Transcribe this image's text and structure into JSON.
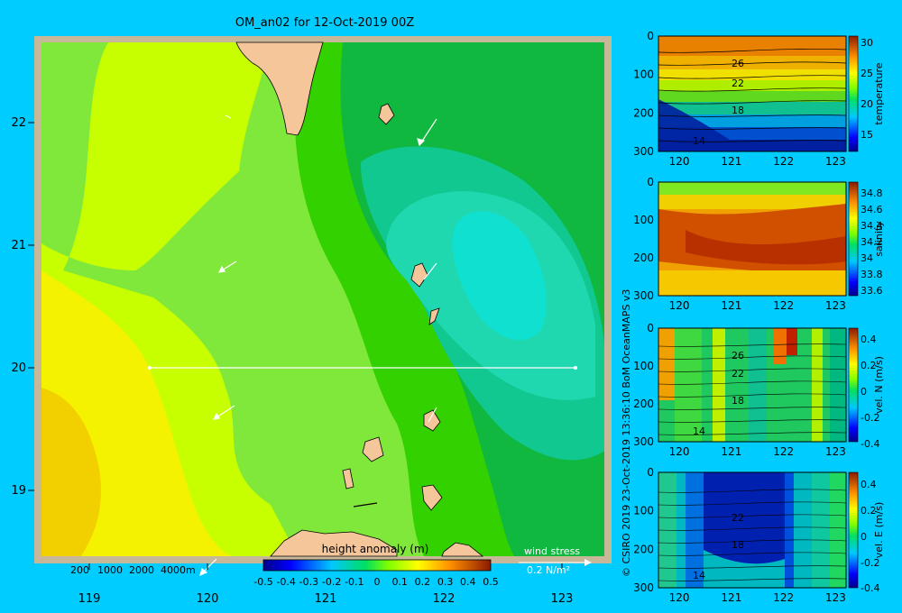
{
  "title": "OM_an02 for 12-Oct-2019 00Z",
  "credit": "© CSIRO 2019   23-Oct-2019 13:36:10 BoM OceanMAPS v3",
  "colors": {
    "background": "#00ccff",
    "land": "#f5c69a",
    "frame": "#c8b89a",
    "transect": "#ffffff",
    "wind_vector": "#ffffff"
  },
  "map": {
    "x_ticks": [
      "119",
      "120",
      "121",
      "122",
      "123"
    ],
    "y_ticks": [
      "22",
      "21",
      "20",
      "19"
    ],
    "depth_labels": [
      "200",
      "1000",
      "2000",
      "4000m"
    ],
    "colorbar_title": "height anomaly (m)",
    "colorbar_ticks": [
      "-0.5",
      "-0.4",
      "-0.3",
      "-0.2",
      "-0.1",
      "0",
      "0.1",
      "0.2",
      "0.3",
      "0.4",
      "0.5"
    ],
    "wind_stress_label": "wind stress",
    "wind_stress_value": "0.2 N/m²"
  },
  "panels": [
    {
      "id": "temperature",
      "ylabel": "temperature",
      "cbar_ticks": [
        "30",
        "25",
        "20",
        "15"
      ],
      "contour_labels": [
        "26",
        "22",
        "18",
        "14"
      ]
    },
    {
      "id": "salinity",
      "ylabel": "salinity",
      "cbar_ticks": [
        "34.8",
        "34.6",
        "34.4",
        "34.2",
        "34",
        "33.8",
        "33.6"
      ],
      "contour_labels": []
    },
    {
      "id": "vel-n",
      "ylabel": "vel. N (m/s)",
      "cbar_ticks": [
        "0.4",
        "0.2",
        "0",
        "-0.2",
        "-0.4"
      ],
      "contour_labels": [
        "26",
        "22",
        "18",
        "14"
      ]
    },
    {
      "id": "vel-e",
      "ylabel": "vel. E (m/s)",
      "cbar_ticks": [
        "0.4",
        "0.2",
        "0",
        "-0.2",
        "-0.4"
      ],
      "contour_labels": [
        "22",
        "18",
        "14"
      ]
    }
  ],
  "panel_axes": {
    "y_ticks": [
      "0",
      "100",
      "200",
      "300"
    ],
    "x_ticks": [
      "120",
      "121",
      "122",
      "123"
    ]
  },
  "chart_data": [
    {
      "type": "heatmap",
      "title": "OM_an02 for 12-Oct-2019 00Z",
      "variable": "height anomaly (m)",
      "x_range": [
        118.5,
        123.5
      ],
      "y_range": [
        18.3,
        22.7
      ],
      "color_range": [
        -0.5,
        0.5
      ],
      "transect": {
        "lon": [
          119.5,
          123.2
        ],
        "lat": [
          20,
          20
        ]
      },
      "min_anomaly_center": {
        "lon": 122.5,
        "lat": 20.8
      }
    },
    {
      "type": "heatmap",
      "variable": "temperature",
      "x_range": [
        119.6,
        123.2
      ],
      "y_range": [
        300,
        0
      ],
      "color_range": [
        13,
        31
      ],
      "contours": [
        26,
        22,
        18,
        14
      ]
    },
    {
      "type": "heatmap",
      "variable": "salinity",
      "x_range": [
        119.6,
        123.2
      ],
      "y_range": [
        300,
        0
      ],
      "color_range": [
        33.55,
        34.9
      ]
    },
    {
      "type": "heatmap",
      "variable": "vel. N (m/s)",
      "x_range": [
        119.6,
        123.2
      ],
      "y_range": [
        300,
        0
      ],
      "color_range": [
        -0.45,
        0.45
      ]
    },
    {
      "type": "heatmap",
      "variable": "vel. E (m/s)",
      "x_range": [
        119.6,
        123.2
      ],
      "y_range": [
        300,
        0
      ],
      "color_range": [
        -0.45,
        0.45
      ]
    }
  ]
}
